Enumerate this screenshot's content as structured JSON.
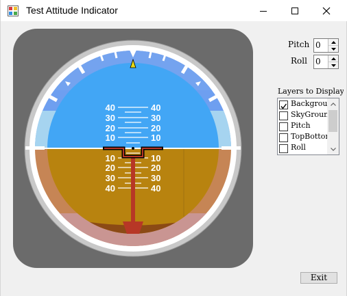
{
  "window": {
    "title": "Test Attitude Indicator"
  },
  "controls": {
    "pitch_label": "Pitch",
    "pitch_value": "0",
    "roll_label": "Roll",
    "roll_value": "0"
  },
  "layers": {
    "label": "Layers to Display",
    "items": [
      {
        "label": "Background",
        "checked": true
      },
      {
        "label": "SkyGround",
        "checked": false
      },
      {
        "label": "Pitch",
        "checked": false
      },
      {
        "label": "TopBottom",
        "checked": false
      },
      {
        "label": "Roll",
        "checked": false
      }
    ]
  },
  "pitch_ladder": {
    "up_labels": [
      "40",
      "30",
      "20",
      "10"
    ],
    "down_labels": [
      "10",
      "20",
      "30",
      "40"
    ]
  },
  "exit_label": "Exit",
  "colors": {
    "sky": "#42a6f5",
    "ground": "#b8830f",
    "bezel": "#6b6b6b",
    "sky_band": "#6e9ff0",
    "ground_band": "#c68555",
    "pointer": "#e7d817"
  }
}
